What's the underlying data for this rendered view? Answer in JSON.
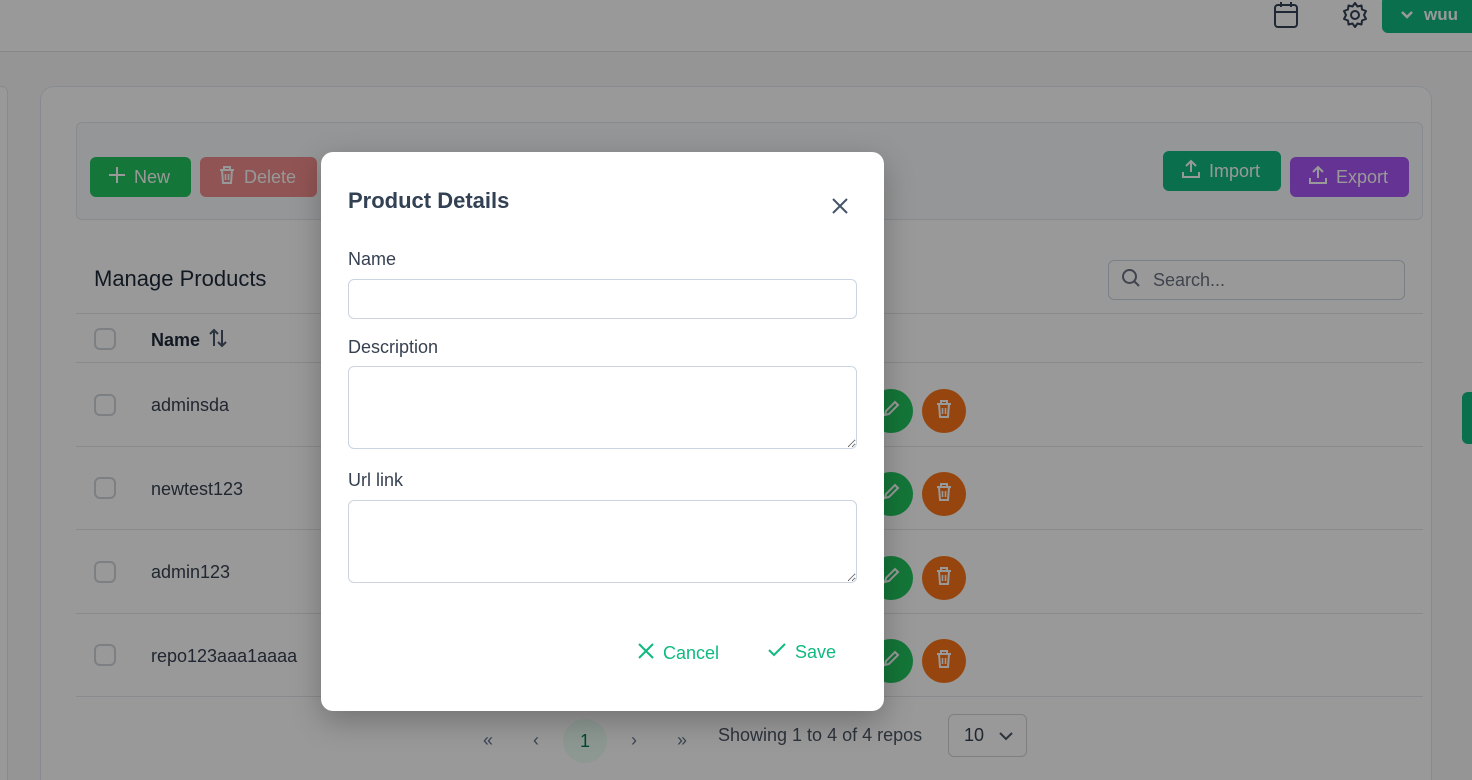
{
  "topbar": {
    "icons": [
      "calendar-icon",
      "gear-icon"
    ],
    "user_label": "wuu"
  },
  "toolbar": {
    "new_label": "New",
    "delete_label": "Delete",
    "import_label": "Import",
    "export_label": "Export"
  },
  "table": {
    "title": "Manage Products",
    "search_placeholder": "Search...",
    "column_name": "Name",
    "rows": [
      {
        "name": "adminsda"
      },
      {
        "name": "newtest123"
      },
      {
        "name": "admin123"
      },
      {
        "name": "repo123aaa1aaaa"
      }
    ]
  },
  "pagination": {
    "first": "«",
    "prev": "‹",
    "current_page": "1",
    "next": "›",
    "last": "»",
    "info": "Showing 1 to 4 of 4 repos",
    "page_size": "10"
  },
  "dialog": {
    "title": "Product Details",
    "name_label": "Name",
    "name_value": "",
    "description_label": "Description",
    "description_value": "",
    "url_label": "Url link",
    "url_value": "",
    "cancel_label": "Cancel",
    "save_label": "Save"
  },
  "colors": {
    "accent": "#10b981",
    "success": "#22c55e",
    "danger": "#ef4444",
    "warning": "#f97316",
    "help": "#a855f7"
  }
}
